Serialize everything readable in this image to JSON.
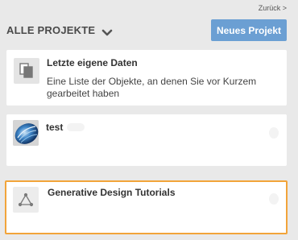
{
  "nav": {
    "back_label": "Zurück >"
  },
  "header": {
    "title": "ALLE PROJEKTE"
  },
  "actions": {
    "new_project_label": "Neues Projekt"
  },
  "projects": [
    {
      "title": "Letzte eigene Daten",
      "description": "Eine Liste der Objekte, an denen Sie vor Kurzem gearbeitet haben",
      "icon": "documents-icon"
    },
    {
      "title": "test",
      "icon": "project-thumbnail"
    },
    {
      "title": "Generative Design Tutorials",
      "icon": "generative-design-icon",
      "selected": true
    }
  ],
  "colors": {
    "accent_button": "#6b9fd3",
    "selection_border": "#f2a43a",
    "panel_background": "#e9e9e9"
  }
}
